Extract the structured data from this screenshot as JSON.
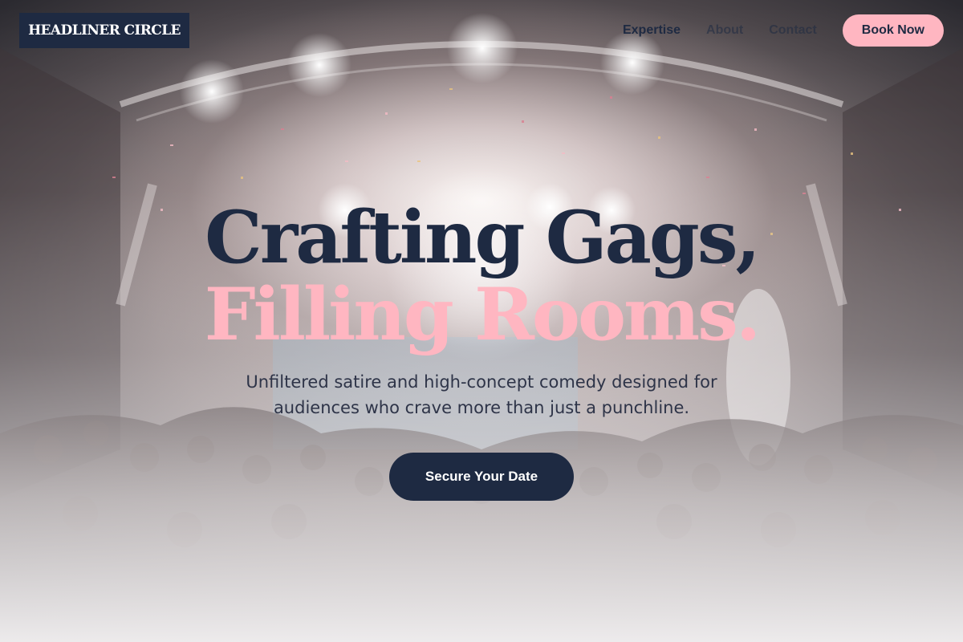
{
  "brand": {
    "name": "HEADLINER CIRCLE"
  },
  "nav": {
    "items": [
      {
        "label": "Expertise"
      },
      {
        "label": "About"
      },
      {
        "label": "Contact"
      }
    ],
    "book_label": "Book Now"
  },
  "hero": {
    "headline_line1": "Crafting Gags,",
    "headline_line2": "Filling Rooms.",
    "subtitle": "Unfiltered satire and high-concept comedy designed for audiences who crave more than just a punchline.",
    "cta_label": "Secure Your Date",
    "background": "concert-crowd-confetti-photo"
  },
  "colors": {
    "navy": "#1e2a42",
    "pink": "#ffb6c1",
    "text": "#2e3448"
  }
}
